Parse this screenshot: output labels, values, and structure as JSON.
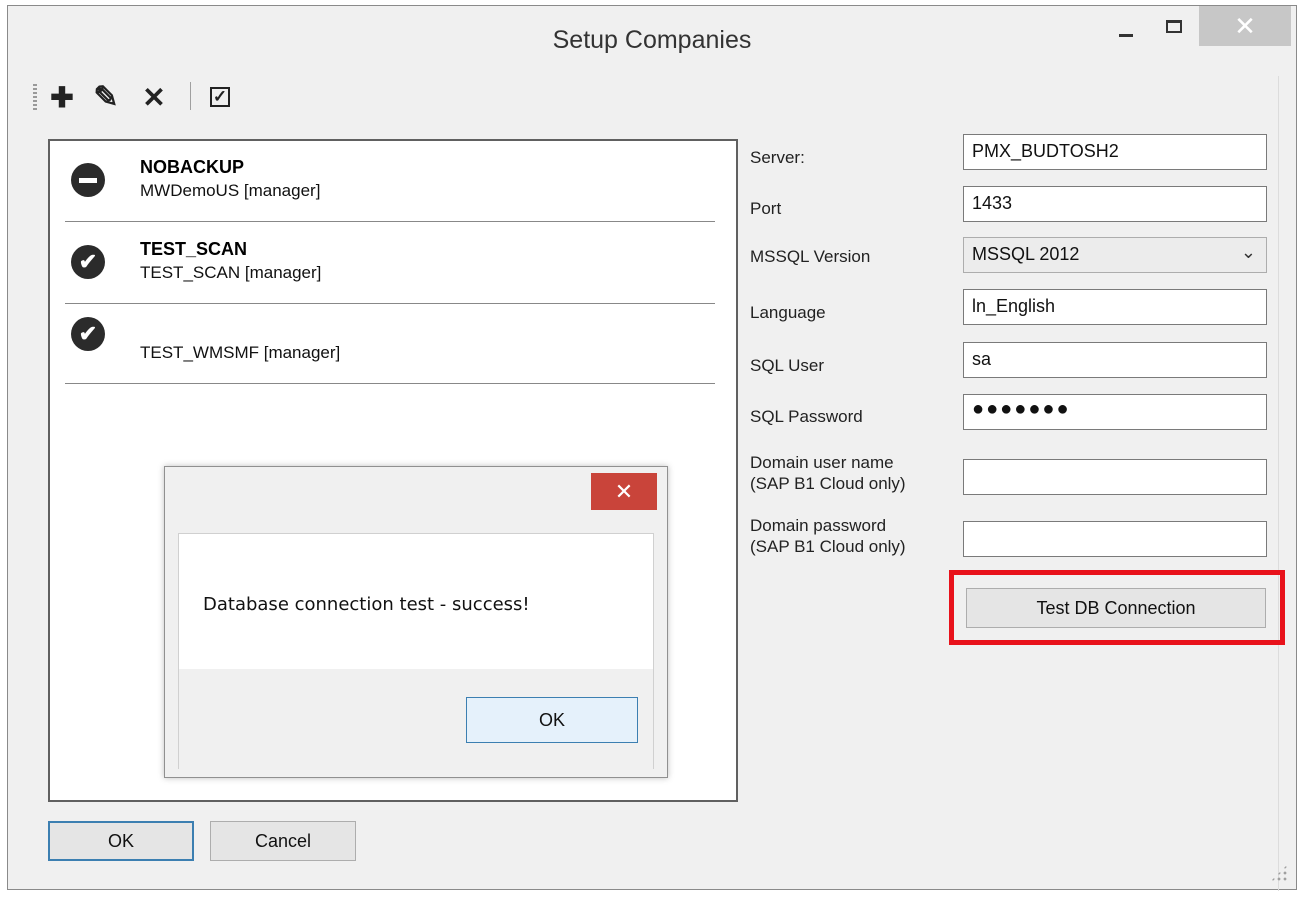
{
  "window": {
    "title": "Setup Companies",
    "close_glyph": "✕"
  },
  "toolbar": {
    "add_icon": "plus-icon",
    "edit_icon": "pencil-icon",
    "delete_icon": "x-icon",
    "check_icon": "checkbox-icon",
    "add_glyph": "✚",
    "edit_glyph": "✎",
    "delete_glyph": "✕",
    "check_glyph": "✓"
  },
  "companies": [
    {
      "name": "NOBACKUP",
      "db": "MWDemoUS [manager]",
      "status": "blocked",
      "status_glyph": ""
    },
    {
      "name": "TEST_SCAN",
      "db": "TEST_SCAN [manager]",
      "status": "ok",
      "status_glyph": "✔"
    },
    {
      "name": "",
      "db": "TEST_WMSMF [manager]",
      "status": "ok",
      "status_glyph": "✔"
    }
  ],
  "form": {
    "server_label": "Server:",
    "server_value": "PMX_BUDTOSH2",
    "port_label": "Port",
    "port_value": "1433",
    "mssql_label": "MSSQL Version",
    "mssql_value": "MSSQL 2012",
    "chevron": "⌄",
    "language_label": "Language",
    "language_value": "ln_English",
    "user_label": "SQL User",
    "user_value": "sa",
    "password_label": "SQL Password",
    "password_value": "●●●●●●●",
    "domain_user_label_1": "Domain user name",
    "domain_user_label_2": "(SAP B1 Cloud only)",
    "domain_user_value": "",
    "domain_pass_label_1": "Domain password",
    "domain_pass_label_2": "(SAP B1 Cloud only)",
    "domain_pass_value": "",
    "test_button": "Test DB Connection"
  },
  "buttons": {
    "ok": "OK",
    "cancel": "Cancel"
  },
  "dialog": {
    "message": "Database connection test - success!",
    "ok": "OK",
    "close_glyph": "✕"
  },
  "colors": {
    "highlight": "#e8121b",
    "dialog_close": "#c9443a",
    "focus_border": "#3c7fb1"
  }
}
